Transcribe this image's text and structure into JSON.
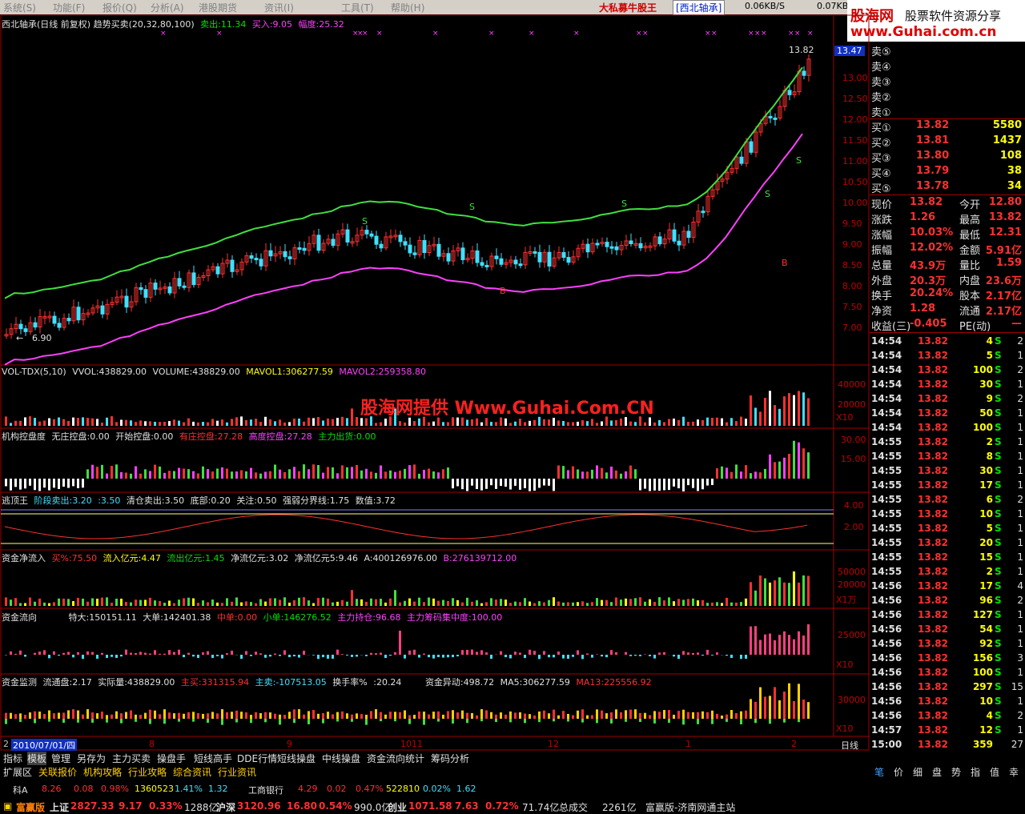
{
  "menu": {
    "items": [
      "系统(S)",
      "功能(F)",
      "报价(Q)",
      "分析(A)",
      "港股期货",
      "资讯(I)",
      "工具(T)",
      "帮助(H)"
    ],
    "promo": "大私募牛股王",
    "stock": "[西北轴承]",
    "speed_down": "0.06KB/S",
    "speed_up": "0.07KB/"
  },
  "logo": {
    "brand": "股海网",
    "slogan": "股票软件资源分享",
    "url": "www.Guhai.com.cn"
  },
  "main_panel": {
    "title": "西北轴承(日线 前复权) 趋势买卖(20,32,80,100)",
    "sell": "卖出:11.34",
    "buy": "买入:9.05",
    "amp": "幅度:25.32",
    "price_ticks": [
      "13.00",
      "12.50",
      "12.00",
      "11.50",
      "11.00",
      "10.50",
      "10.00",
      "9.50",
      "9.00",
      "8.50",
      "8.00",
      "7.50",
      "7.00"
    ],
    "current_tag": "13.47",
    "high_label": "13.82",
    "low_label": "6.90",
    "signal_s": "S",
    "signal_b": "B"
  },
  "vol_panel": {
    "label": "VOL-TDX(5,10)",
    "vvol": "VVOL:438829.00",
    "volume": "VOLUME:438829.00",
    "mavol1": "MAVOL1:306277.59",
    "mavol2": "MAVOL2:259358.80",
    "ticks": [
      "40000",
      "20000"
    ],
    "unit": "X10",
    "watermark": "股海网提供 Www.Guhai.Com.CN"
  },
  "control_panel": {
    "label": "机构控盘度",
    "a": "无庄控盘:0.00",
    "b": "开始控盘:0.00",
    "c": "有庄控盘:27.28",
    "d": "高度控盘:27.28",
    "e": "主力出货:0.00",
    "ticks": [
      "30.00",
      "15.00"
    ]
  },
  "escape_panel": {
    "label": "逃顶王",
    "a": "阶段卖出:3.20",
    "b": ":3.50",
    "c": "清仓卖出:3.50",
    "d": "底部:0.20",
    "e": "关注:0.50",
    "f": "强弱分界线:1.75",
    "g": "数值:3.72",
    "ticks": [
      "4.00",
      "2.00"
    ]
  },
  "netflow_panel": {
    "label": "资金净流入",
    "a": "买%:75.50",
    "b": "流入亿元:4.47",
    "c": "流出亿元:1.45",
    "d": "净流亿元:3.02",
    "e": "净流亿元5:9.46",
    "f": "A:400126976.00",
    "g": "B:276139712.00",
    "ticks": [
      "50000",
      "20000"
    ],
    "unit": "X1万"
  },
  "flow_panel": {
    "label": "资金流向",
    "a": "特大:150151.11",
    "b": "大单:142401.38",
    "c": "中单:0.00",
    "d": "小单:146276.52",
    "e": "主力持仓:96.68",
    "f": "主力筹码集中度:100.00",
    "ticks": [
      "25000"
    ],
    "unit": "X10"
  },
  "monitor_panel": {
    "label": "资金监测",
    "a": "流通盘:2.17",
    "b": "实际量:438829.00",
    "c": "主买:331315.94",
    "d": "主卖:-107513.05",
    "e": "换手率%",
    "f": ":20.24",
    "g": "资金异动:498.72",
    "h": "MA5:306277.59",
    "i": "MA13:225556.92",
    "ticks": [
      "30000"
    ],
    "unit": "X10"
  },
  "date_axis": {
    "start": "2010/07/01/四",
    "lead": "2",
    "months": [
      "8",
      "9",
      "10",
      "11",
      "12",
      "1",
      "2"
    ],
    "mode": "日线"
  },
  "quote": {
    "asks": [
      {
        "label": "卖⑤"
      },
      {
        "label": "卖④"
      },
      {
        "label": "卖③"
      },
      {
        "label": "卖②"
      },
      {
        "label": "卖①"
      }
    ],
    "bids": [
      {
        "label": "买①",
        "price": "13.82",
        "vol": "5580"
      },
      {
        "label": "买②",
        "price": "13.81",
        "vol": "1437"
      },
      {
        "label": "买③",
        "price": "13.80",
        "vol": "108"
      },
      {
        "label": "买④",
        "price": "13.79",
        "vol": "38"
      },
      {
        "label": "买⑤",
        "price": "13.78",
        "vol": "34"
      }
    ],
    "stats": [
      {
        "k1": "现价",
        "v1": "13.82",
        "k2": "今开",
        "v2": "12.80"
      },
      {
        "k1": "涨跌",
        "v1": "1.26",
        "k2": "最高",
        "v2": "13.82"
      },
      {
        "k1": "涨幅",
        "v1": "10.03%",
        "k2": "最低",
        "v2": "12.31"
      },
      {
        "k1": "振幅",
        "v1": "12.02%",
        "k2": "金额",
        "v2": "5.91亿"
      },
      {
        "k1": "总量",
        "v1": "43.9万",
        "k2": "量比",
        "v2": "1.59"
      },
      {
        "k1": "外盘",
        "v1": "20.3万",
        "k2": "内盘",
        "v2": "23.6万"
      },
      {
        "k1": "换手",
        "v1": "20.24%",
        "k2": "股本",
        "v2": "2.17亿"
      },
      {
        "k1": "净资",
        "v1": "1.28",
        "k2": "流通",
        "v2": "2.17亿"
      },
      {
        "k1": "收益(三)",
        "v1": "-0.405",
        "k2": "PE(动)",
        "v2": "—"
      }
    ],
    "ticks": [
      {
        "t": "14:54",
        "p": "13.82",
        "v": "4",
        "s": "S",
        "n": "2"
      },
      {
        "t": "14:54",
        "p": "13.82",
        "v": "5",
        "s": "S",
        "n": "1"
      },
      {
        "t": "14:54",
        "p": "13.82",
        "v": "100",
        "s": "S",
        "n": "2"
      },
      {
        "t": "14:54",
        "p": "13.82",
        "v": "30",
        "s": "S",
        "n": "1"
      },
      {
        "t": "14:54",
        "p": "13.82",
        "v": "9",
        "s": "S",
        "n": "2"
      },
      {
        "t": "14:54",
        "p": "13.82",
        "v": "50",
        "s": "S",
        "n": "1"
      },
      {
        "t": "14:54",
        "p": "13.82",
        "v": "100",
        "s": "S",
        "n": "1"
      },
      {
        "t": "14:55",
        "p": "13.82",
        "v": "2",
        "s": "S",
        "n": "1"
      },
      {
        "t": "14:55",
        "p": "13.82",
        "v": "8",
        "s": "S",
        "n": "1"
      },
      {
        "t": "14:55",
        "p": "13.82",
        "v": "30",
        "s": "S",
        "n": "1"
      },
      {
        "t": "14:55",
        "p": "13.82",
        "v": "17",
        "s": "S",
        "n": "1"
      },
      {
        "t": "14:55",
        "p": "13.82",
        "v": "6",
        "s": "S",
        "n": "2"
      },
      {
        "t": "14:55",
        "p": "13.82",
        "v": "10",
        "s": "S",
        "n": "1"
      },
      {
        "t": "14:55",
        "p": "13.82",
        "v": "5",
        "s": "S",
        "n": "1"
      },
      {
        "t": "14:55",
        "p": "13.82",
        "v": "20",
        "s": "S",
        "n": "1"
      },
      {
        "t": "14:55",
        "p": "13.82",
        "v": "15",
        "s": "S",
        "n": "1"
      },
      {
        "t": "14:55",
        "p": "13.82",
        "v": "2",
        "s": "S",
        "n": "1"
      },
      {
        "t": "14:56",
        "p": "13.82",
        "v": "17",
        "s": "S",
        "n": "4"
      },
      {
        "t": "14:56",
        "p": "13.82",
        "v": "96",
        "s": "S",
        "n": "2"
      },
      {
        "t": "14:56",
        "p": "13.82",
        "v": "127",
        "s": "S",
        "n": "1"
      },
      {
        "t": "14:56",
        "p": "13.82",
        "v": "54",
        "s": "S",
        "n": "1"
      },
      {
        "t": "14:56",
        "p": "13.82",
        "v": "92",
        "s": "S",
        "n": "1"
      },
      {
        "t": "14:56",
        "p": "13.82",
        "v": "156",
        "s": "S",
        "n": "3"
      },
      {
        "t": "14:56",
        "p": "13.82",
        "v": "100",
        "s": "S",
        "n": "1"
      },
      {
        "t": "14:56",
        "p": "13.82",
        "v": "297",
        "s": "S",
        "n": "15"
      },
      {
        "t": "14:56",
        "p": "13.82",
        "v": "10",
        "s": "S",
        "n": "1"
      },
      {
        "t": "14:56",
        "p": "13.82",
        "v": "4",
        "s": "S",
        "n": "2"
      },
      {
        "t": "14:57",
        "p": "13.82",
        "v": "12",
        "s": "S",
        "n": "1"
      },
      {
        "t": "15:00",
        "p": "13.82",
        "v": "359",
        "s": "",
        "n": "27"
      }
    ]
  },
  "tabs_row1": [
    "指标",
    "模板",
    "管理",
    "另存为",
    "主力买卖",
    "操盘手",
    "短线高手",
    "DDE行情",
    "短线操盘",
    "中线操盘",
    "资金流向统计",
    "筹码分析"
  ],
  "tabs_row2": [
    "扩展区",
    "关联报价",
    "机构攻略",
    "行业攻略",
    "综合资讯",
    "行业资讯"
  ],
  "right_tabs": [
    "笔",
    "价",
    "细",
    "盘",
    "势",
    "指",
    "值",
    "幸"
  ],
  "ticker": {
    "name": "科A",
    "a": "8.26",
    "b": "0.08",
    "c": "0.98%",
    "d": "1360523",
    "e": "1.41%",
    "f": "1.32",
    "name2": "工商银行",
    "g": "4.29",
    "h": "0.02",
    "i": "0.47%",
    "j": "522810",
    "k": "0.02%",
    "l": "1.62"
  },
  "status": {
    "brand": "富赢版",
    "sh": "上证",
    "sh_v": "2827.33",
    "sh_c": "9.17",
    "sh_p": "0.33%",
    "sh_amt": "1288亿",
    "sz": "沪深",
    "sz_v": "3120.96",
    "sz_c": "16.80",
    "sz_p": "0.54%",
    "sz_amt": "990.0亿",
    "cy": "创业",
    "cy_v": "1071.58",
    "cy_c": "7.63",
    "cy_p": "0.72%",
    "cy_amt": "71.74亿",
    "total": "总成交",
    "total_v": "2261亿",
    "site": "富赢版-济南网通主站"
  },
  "colors": {
    "up": "#ff3030",
    "down": "#40e0ff",
    "upper_band": "#40e040",
    "lower_band": "#ff40ff",
    "grid": "#800000"
  }
}
